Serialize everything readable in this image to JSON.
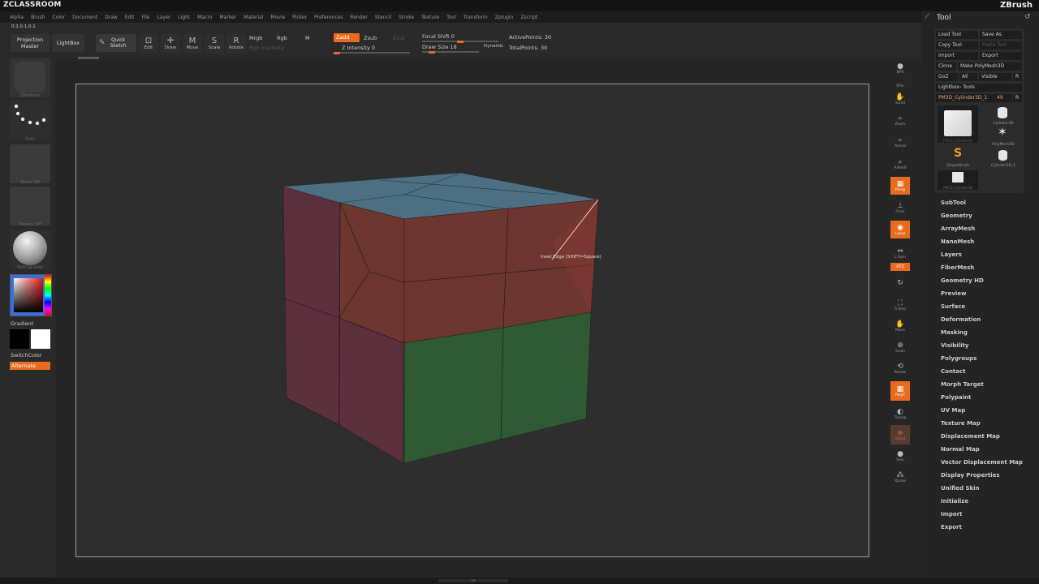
{
  "app": {
    "brand_left": "ZCLASSROOM",
    "brand_right": "ZBrush"
  },
  "menu": [
    "Alpha",
    "Brush",
    "Color",
    "Document",
    "Draw",
    "Edit",
    "File",
    "Layer",
    "Light",
    "Macro",
    "Marker",
    "Material",
    "Movie",
    "Picker",
    "Preferences",
    "Render",
    "Stencil",
    "Stroke",
    "Texture",
    "Tool",
    "Transform",
    "Zplugin",
    "Zscript"
  ],
  "toolbar": {
    "coords": "0.2,0.1,0.1",
    "projection_master": "Projection Master",
    "lightbox": "LightBox",
    "quick_sketch": "Quick Sketch",
    "edit": "Edit",
    "draw": "Draw",
    "move": "Move",
    "scale": "Scale",
    "rotate": "Rotate",
    "mrgb": "Mrgb",
    "rgb": "Rgb",
    "m": "M",
    "rgb_intensity": "Rgb Intensity",
    "zadd": "Zadd",
    "zsub": "Zsub",
    "zcut": "Zcut",
    "z_intensity": "Z Intensity 0",
    "focal_shift": "Focal Shift 0",
    "draw_size": "Draw Size 18",
    "dynamic": "Dynamic",
    "active_points": "ActivePoints: 30",
    "total_points": "TotalPoints: 30"
  },
  "left": {
    "thumbs": [
      "ZModeler",
      "Dots",
      "Alpha Off",
      "Texture Off",
      "MatCap Gray"
    ],
    "gradient": "Gradient",
    "switch_color": "SwitchColor",
    "alternate": "Alternate"
  },
  "tooltip": "Inset Edge (SHIFT=Square)",
  "shelf": [
    "BPR",
    "SPix",
    "Scroll",
    "Zoom",
    "Actual",
    "AAHalf",
    "Persp",
    "Floor",
    "Local",
    "L.Sym",
    "XYZ",
    "Frame",
    "Move",
    "Scale",
    "Rotate",
    "PolyF",
    "Transp",
    "Ghost",
    "Solo",
    "Xpose"
  ],
  "tool": {
    "title": "Tool",
    "load_tool": "Load Tool",
    "save_as": "Save As",
    "copy_tool": "Copy Tool",
    "paste_tool": "Paste Tool",
    "import": "Import",
    "export": "Export",
    "clone": "Clone",
    "make_polymesh": "Make PolyMesh3D",
    "goz": "GoZ",
    "all": "All",
    "visible": "Visible",
    "r": "R",
    "lightbox_tools": "Lightbox› Tools",
    "current_tool": "PM3D_Cylinder3D_1.",
    "current_value": "49",
    "thumbs": [
      "PM3D_Cylinder3D",
      "Cylinder3D",
      "PolyMesh3D",
      "SimpleBrush",
      "Cylinder3D_1",
      "PM3D_Cylinder3D"
    ],
    "subpalettes": [
      "SubTool",
      "Geometry",
      "ArrayMesh",
      "NanoMesh",
      "Layers",
      "FiberMesh",
      "Geometry HD",
      "Preview",
      "Surface",
      "Deformation",
      "Masking",
      "Visibility",
      "Polygroups",
      "Contact",
      "Morph Target",
      "Polypaint",
      "UV Map",
      "Texture Map",
      "Displacement Map",
      "Normal Map",
      "Vector Displacement Map",
      "Display Properties",
      "Unified Skin",
      "Initialize",
      "Import",
      "Export"
    ]
  },
  "colors": {
    "accent": "#e86b1e",
    "top_face": "#4d6f82",
    "front_red": "#6e3630",
    "front_green": "#2f5a34",
    "side_face": "#5c2f3d"
  }
}
